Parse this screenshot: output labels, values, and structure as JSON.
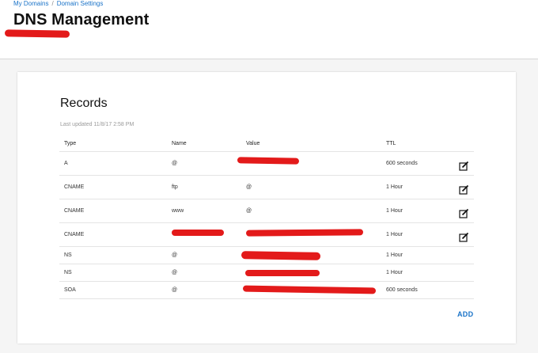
{
  "breadcrumb": {
    "items": [
      "My Domains",
      "Domain Settings"
    ],
    "separator": "/"
  },
  "page_title": "DNS Management",
  "records": {
    "title": "Records",
    "last_updated": "Last updated 11/8/17 2:58 PM",
    "columns": [
      "Type",
      "Name",
      "Value",
      "TTL"
    ],
    "rows": [
      {
        "type": "A",
        "name": "@",
        "value": "",
        "ttl": "600 seconds",
        "editable": true
      },
      {
        "type": "CNAME",
        "name": "ftp",
        "value": "@",
        "ttl": "1 Hour",
        "editable": true
      },
      {
        "type": "CNAME",
        "name": "www",
        "value": "@",
        "ttl": "1 Hour",
        "editable": true
      },
      {
        "type": "CNAME",
        "name": "",
        "value": "",
        "ttl": "1 Hour",
        "editable": true
      },
      {
        "type": "NS",
        "name": "@",
        "value": "",
        "ttl": "1 Hour",
        "editable": false
      },
      {
        "type": "NS",
        "name": "@",
        "value": "",
        "ttl": "1 Hour",
        "editable": false
      },
      {
        "type": "SOA",
        "name": "@",
        "value": "",
        "ttl": "600 seconds",
        "editable": false
      }
    ],
    "add_label": "ADD"
  },
  "colors": {
    "accent": "#1a73c8",
    "redaction": "#e31a1a"
  },
  "icons": {
    "edit": "edit-icon"
  }
}
